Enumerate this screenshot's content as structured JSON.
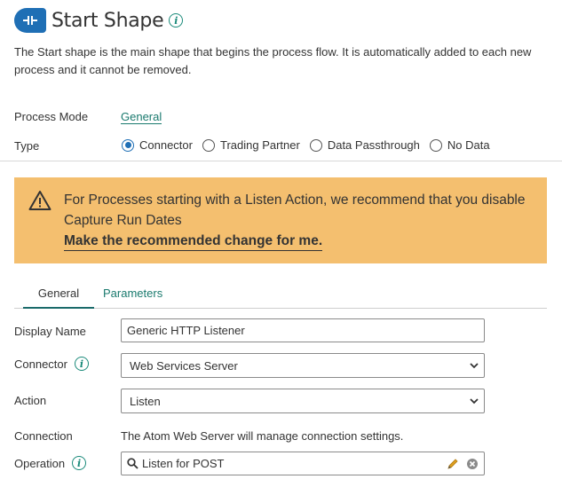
{
  "header": {
    "title": "Start Shape",
    "icon": "start-shape-icon",
    "info_icon": "info-icon",
    "info_glyph": "i"
  },
  "description": "The Start shape is the main shape that begins the process flow. It is automatically added to each new process and it cannot be removed.",
  "process_mode": {
    "label": "Process Mode",
    "value": "General"
  },
  "type": {
    "label": "Type",
    "options": [
      {
        "label": "Connector",
        "checked": true
      },
      {
        "label": "Trading Partner",
        "checked": false
      },
      {
        "label": "Data Passthrough",
        "checked": false
      },
      {
        "label": "No Data",
        "checked": false
      }
    ]
  },
  "warning": {
    "icon": "warning-icon",
    "message": "For Processes starting with a Listen Action, we recommend that you disable Capture Run Dates",
    "link": "Make the recommended change for me.",
    "color": "#f4bf6f"
  },
  "tabs": [
    {
      "label": "General",
      "active": true
    },
    {
      "label": "Parameters",
      "active": false
    }
  ],
  "form": {
    "display_name": {
      "label": "Display Name",
      "value": "Generic HTTP Listener"
    },
    "connector": {
      "label": "Connector",
      "value": "Web Services Server"
    },
    "action": {
      "label": "Action",
      "value": "Listen"
    },
    "connection": {
      "label": "Connection",
      "text": "The Atom Web Server will manage connection settings."
    },
    "operation": {
      "label": "Operation",
      "value": "Listen for POST"
    }
  },
  "colors": {
    "accent": "#1f6fb5",
    "link": "#1a7a6e",
    "warning_bg": "#f4bf6f"
  }
}
